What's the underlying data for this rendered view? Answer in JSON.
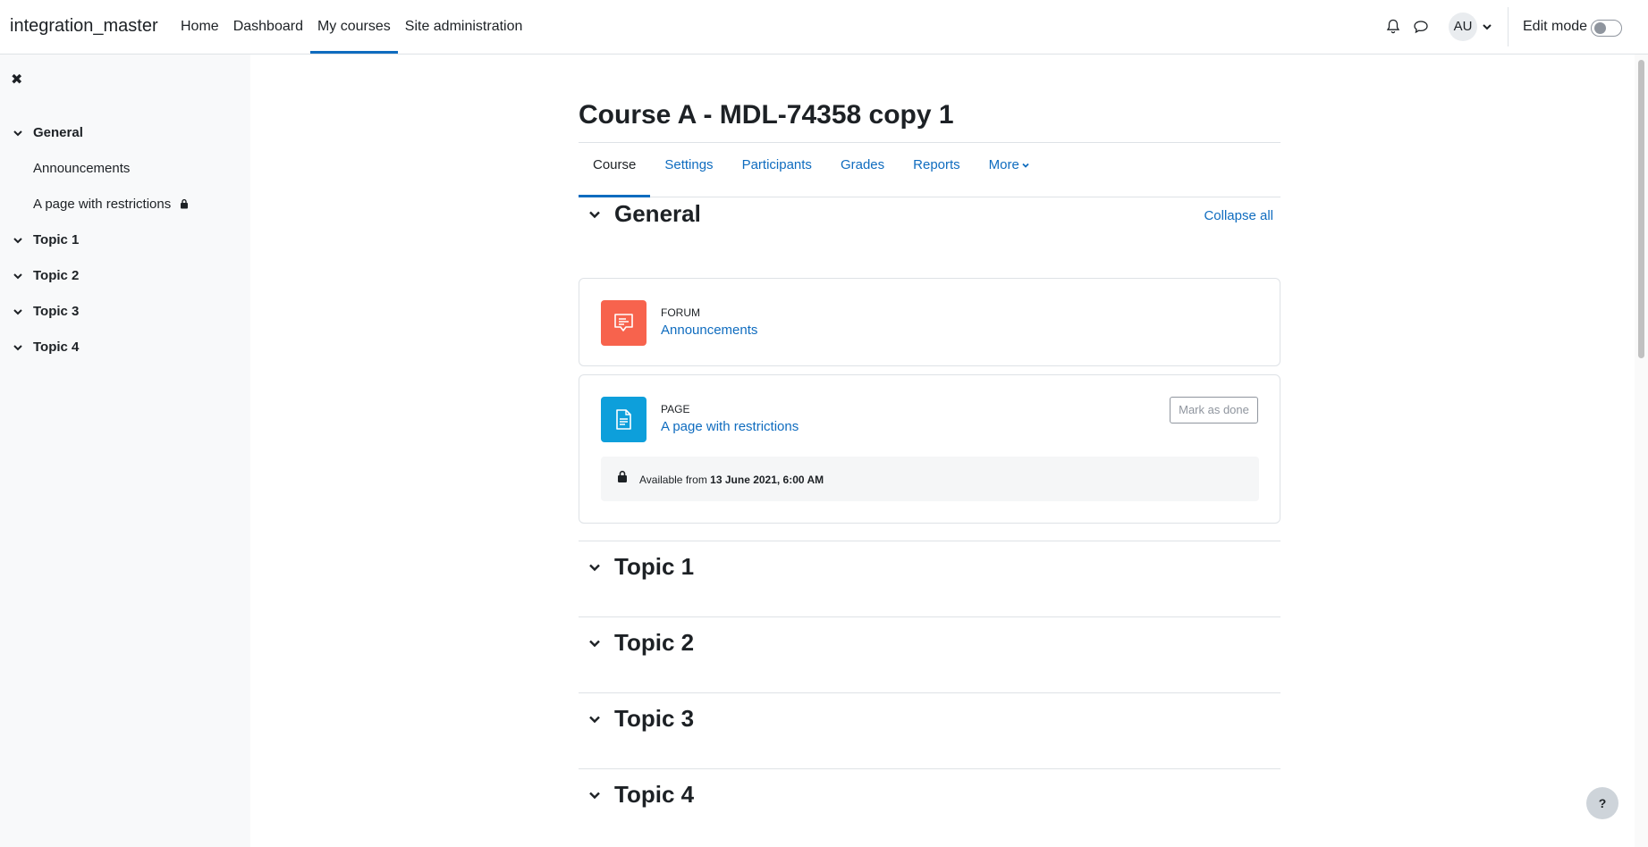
{
  "navbar": {
    "brand": "integration_master",
    "items": [
      {
        "label": "Home",
        "active": false
      },
      {
        "label": "Dashboard",
        "active": false
      },
      {
        "label": "My courses",
        "active": true
      },
      {
        "label": "Site administration",
        "active": false
      }
    ],
    "avatar_initials": "AU",
    "edit_mode_label": "Edit mode",
    "edit_mode_on": false
  },
  "drawer": {
    "close_icon": "close-icon",
    "general": {
      "label": "General",
      "activities": [
        {
          "label": "Announcements",
          "restricted": false
        },
        {
          "label": "A page with restrictions",
          "restricted": true
        }
      ]
    },
    "topics": [
      "Topic 1",
      "Topic 2",
      "Topic 3",
      "Topic 4"
    ]
  },
  "course": {
    "title": "Course A - MDL-74358 copy 1",
    "tabs": [
      {
        "label": "Course",
        "active": true
      },
      {
        "label": "Settings",
        "active": false
      },
      {
        "label": "Participants",
        "active": false
      },
      {
        "label": "Grades",
        "active": false
      },
      {
        "label": "Reports",
        "active": false
      },
      {
        "label": "More",
        "active": false,
        "dropdown": true
      }
    ],
    "collapse_all": "Collapse all",
    "general_section": {
      "title": "General",
      "activities": [
        {
          "type": "Forum",
          "name": "Announcements",
          "icon": "forum-icon",
          "icon_color": "#f7634d"
        },
        {
          "type": "Page",
          "name": "A page with restrictions",
          "icon": "page-icon",
          "icon_color": "#0d9fdb",
          "mark_as_done": "Mark as done",
          "restriction_prefix": "Available from",
          "restriction_date": "13 June 2021, 6:00 AM"
        }
      ]
    },
    "topics": [
      "Topic 1",
      "Topic 2",
      "Topic 3",
      "Topic 4"
    ]
  },
  "help_button": "?",
  "colors": {
    "link": "#0f6cbf",
    "drawer_bg": "#f8f9fa",
    "border": "#dee2e6"
  }
}
